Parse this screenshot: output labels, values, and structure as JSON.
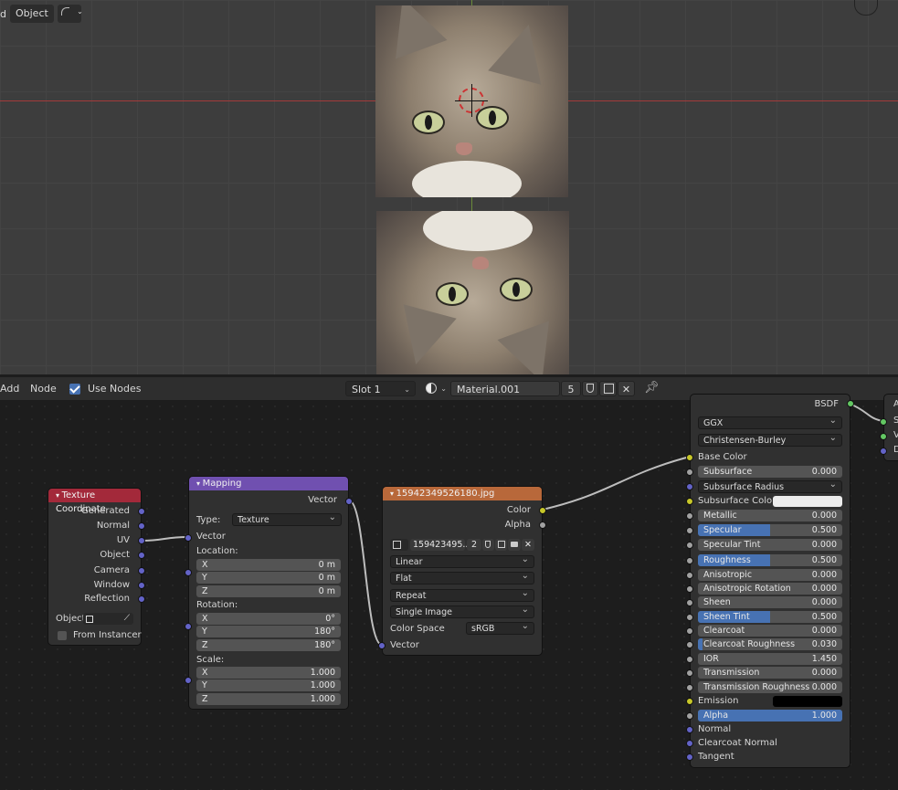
{
  "viewport": {
    "header": {
      "partial_label": "d",
      "mode": "Object"
    }
  },
  "node_editor_header": {
    "menus": [
      "Add",
      "Node"
    ],
    "use_nodes_label": "Use Nodes",
    "use_nodes_checked": true,
    "slot": "Slot 1",
    "material_name": "Material.001",
    "user_count": "5"
  },
  "texture_coordinate": {
    "title": "Texture Coordinate",
    "outputs": [
      "Generated",
      "Normal",
      "UV",
      "Object",
      "Camera",
      "Window",
      "Reflection"
    ],
    "object_label": "Object",
    "from_instancer_label": "From Instancer",
    "color": "#a3293a"
  },
  "mapping": {
    "title": "Mapping",
    "output": "Vector",
    "type_label": "Type:",
    "type_value": "Texture",
    "input_vector": "Vector",
    "location_label": "Location:",
    "location": [
      [
        "X",
        "0 m"
      ],
      [
        "Y",
        "0 m"
      ],
      [
        "Z",
        "0 m"
      ]
    ],
    "rotation_label": "Rotation:",
    "rotation": [
      [
        "X",
        "0°"
      ],
      [
        "Y",
        "180°"
      ],
      [
        "Z",
        "180°"
      ]
    ],
    "scale_label": "Scale:",
    "scale": [
      [
        "X",
        "1.000"
      ],
      [
        "Y",
        "1.000"
      ],
      [
        "Z",
        "1.000"
      ]
    ],
    "color": "#7050b0"
  },
  "image_texture": {
    "title": "15942349526180.jpg",
    "outputs": [
      "Color",
      "Alpha"
    ],
    "image_name": "159423495...",
    "image_users": "2",
    "interpolation": "Linear",
    "projection": "Flat",
    "extension": "Repeat",
    "source": "Single Image",
    "color_space_label": "Color Space",
    "color_space": "sRGB",
    "input_vector": "Vector",
    "color": "#b8683a"
  },
  "bsdf": {
    "output": "BSDF",
    "distribution": "GGX",
    "subsurface_method": "Christensen-Burley",
    "base_color_label": "Base Color",
    "subsurface_radius_label": "Subsurface Radius",
    "subsurface_color_label": "Subsurface Color",
    "emission_label": "Emission",
    "fields": [
      {
        "label": "Subsurface",
        "value": "0.000",
        "fill": 0
      },
      {
        "label": "Metallic",
        "value": "0.000",
        "fill": 0
      },
      {
        "label": "Specular",
        "value": "0.500",
        "fill": 0.5
      },
      {
        "label": "Specular Tint",
        "value": "0.000",
        "fill": 0
      },
      {
        "label": "Roughness",
        "value": "0.500",
        "fill": 0.5
      },
      {
        "label": "Anisotropic",
        "value": "0.000",
        "fill": 0
      },
      {
        "label": "Anisotropic Rotation",
        "value": "0.000",
        "fill": 0
      },
      {
        "label": "Sheen",
        "value": "0.000",
        "fill": 0
      },
      {
        "label": "Sheen Tint",
        "value": "0.500",
        "fill": 0.5
      },
      {
        "label": "Clearcoat",
        "value": "0.000",
        "fill": 0
      },
      {
        "label": "Clearcoat Roughness",
        "value": "0.030",
        "fill": 0.03
      },
      {
        "label": "IOR",
        "value": "1.450",
        "fill": 0
      },
      {
        "label": "Transmission",
        "value": "0.000",
        "fill": 0
      },
      {
        "label": "Transmission Roughness",
        "value": "0.000",
        "fill": 0
      },
      {
        "label": "Alpha",
        "value": "1.000",
        "fill": 1
      }
    ],
    "vector_inputs": [
      "Normal",
      "Clearcoat Normal",
      "Tangent"
    ]
  },
  "output_node": {
    "partial_letters": [
      "A",
      "S",
      "V",
      "D"
    ]
  }
}
